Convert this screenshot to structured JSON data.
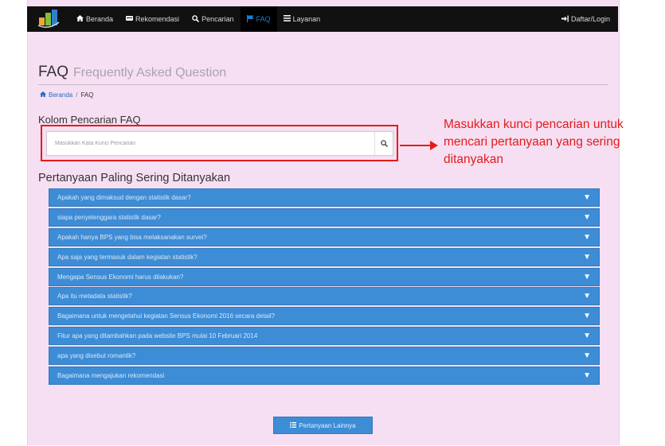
{
  "navbar": {
    "items": [
      {
        "label": "Beranda",
        "icon": "home-icon",
        "glyph": "▲"
      },
      {
        "label": "Rekomendasi",
        "icon": "inbox-icon",
        "glyph": "▬"
      },
      {
        "label": "Pencarian",
        "icon": "search-icon",
        "glyph": "⌕"
      },
      {
        "label": "FAQ",
        "icon": "flag-icon",
        "glyph": "⚑"
      },
      {
        "label": "Layanan",
        "icon": "list-icon",
        "glyph": "≡"
      }
    ],
    "login_label": "Daftar/Login",
    "login_glyph": "→"
  },
  "header": {
    "title": "FAQ",
    "subtitle": "Frequently Asked Question"
  },
  "breadcrumb": {
    "home": "Beranda",
    "separator": "/",
    "current": "FAQ"
  },
  "search": {
    "label": "Kolom Pencarian FAQ",
    "placeholder": "Masukkan Kata Kunci Pencarian",
    "value": ""
  },
  "annotation": {
    "lines": [
      "Masukkan kunci pencarian untuk",
      "mencari pertanyaan yang sering",
      "ditanyakan"
    ]
  },
  "faq": {
    "title": "Pertanyaan Paling Sering Ditanyakan",
    "caret": "▼",
    "items": [
      "Apakah yang dimaksud dengan statistik dasar?",
      "siapa penyelenggara statistik dasar?",
      "Apakah hanya BPS yang bisa melaksanakan survei?",
      "Apa saja yang termasuk dalam kegiatan statistik?",
      "Mengapa Sensus Ekonomi harus dilakukan?",
      "Apa itu metadata statistik?",
      "Bagaimana untuk mengetahui kegiatan Sensus Ekonomi 2016 secara detail?",
      "Fitur apa yang ditambahkan pada website BPS mulai 10 Februari 2014",
      "apa yang disebut romantik?",
      "Bagaimana mengajukan rekomendasi"
    ]
  },
  "more_button": {
    "label": "Pertanyaan Lainnya",
    "glyph": "☰"
  },
  "colors": {
    "accent": "#3d8cd6",
    "annotation": "#e41b1b",
    "background": "#f6dff2",
    "navbar": "#111111"
  }
}
